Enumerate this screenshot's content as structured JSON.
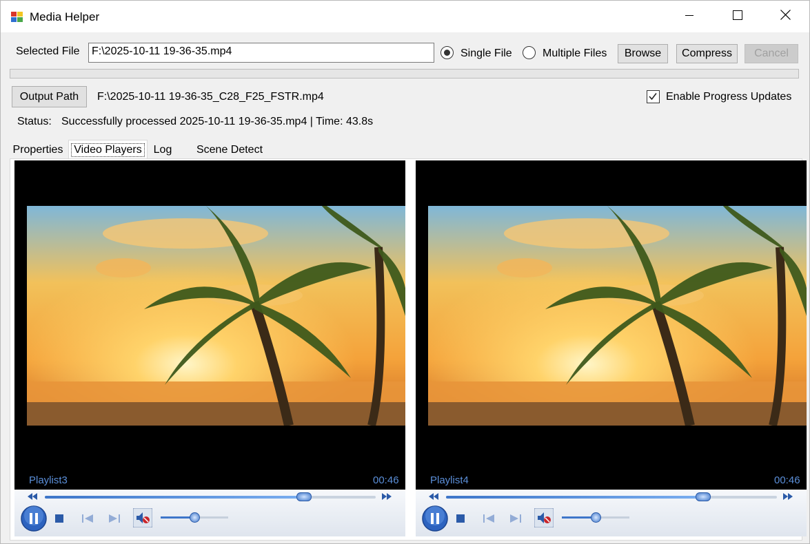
{
  "window": {
    "title": "Media Helper",
    "app_icon": "media-helper-icon",
    "controls": {
      "minimize": "minimize-icon",
      "maximize": "maximize-icon",
      "close": "close-icon"
    }
  },
  "file": {
    "selected_label": "Selected File",
    "selected_value": "F:\\2025-10-11 19-36-35.mp4",
    "mode_single": "Single File",
    "mode_multiple": "Multiple Files",
    "mode_selected": "Single File",
    "browse_label": "Browse",
    "compress_label": "Compress",
    "cancel_label": "Cancel"
  },
  "progress": {
    "value": 0
  },
  "output": {
    "button_label": "Output Path",
    "path": "F:\\2025-10-11 19-36-35_C28_F25_FSTR.mp4",
    "progress_updates_label": "Enable Progress Updates",
    "progress_updates_checked": true
  },
  "status": {
    "label": "Status:",
    "text": "Successfully processed 2025-10-11 19-36-35.mp4 | Time: 43.8s"
  },
  "tabs": [
    {
      "label": "Properties"
    },
    {
      "label": "Video Players",
      "active": true
    },
    {
      "label": "Log"
    },
    {
      "label": "Scene Detect"
    }
  ],
  "players": [
    {
      "playlist": "Playlist3",
      "time": "00:46",
      "seek": 0.79,
      "volume": 0.5,
      "muted": true,
      "state": "playing"
    },
    {
      "playlist": "Playlist4",
      "time": "00:46",
      "seek": 0.78,
      "volume": 0.5,
      "muted": true,
      "state": "playing"
    }
  ],
  "colors": {
    "accent": "#3e76c9",
    "label_blue": "#5b8fd9",
    "window_bg": "#f0f0f0"
  }
}
